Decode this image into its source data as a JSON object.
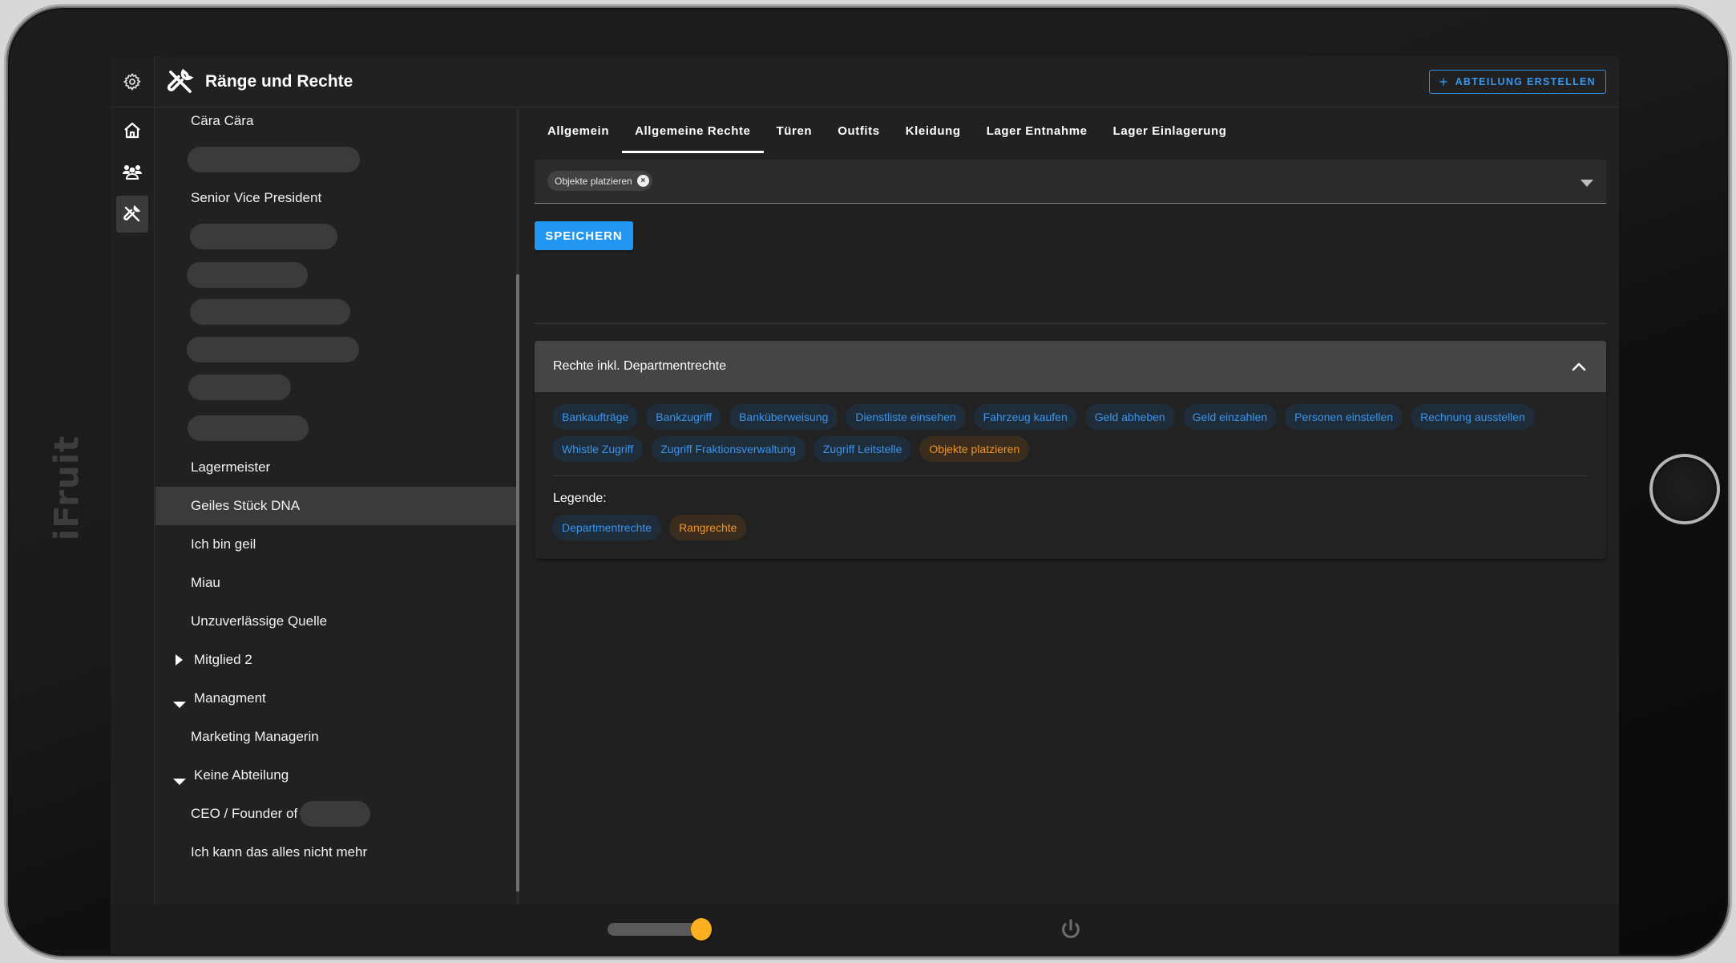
{
  "device": {
    "brand": "iFruit",
    "brand_logo_icon": "ifruit-logo-icon",
    "home_button_icon": "home-button-icon"
  },
  "rail": {
    "items": [
      {
        "name": "settings",
        "icon": "gear-icon",
        "active": false
      },
      {
        "name": "home",
        "icon": "home-icon",
        "active": false
      },
      {
        "name": "members",
        "icon": "users-icon",
        "active": false
      },
      {
        "name": "ranks",
        "icon": "tools-icon",
        "active": true
      }
    ]
  },
  "header": {
    "icon": "tools-icon",
    "title": "Ränge und Rechte",
    "create_button_label": "ABTEILUNG ERSTELLEN",
    "create_button_icon": "plus-icon"
  },
  "rank_list": {
    "items": [
      {
        "label": "Cära Cära",
        "type": "rank"
      },
      {
        "label": "",
        "type": "redacted"
      },
      {
        "label": "Senior Vice President",
        "type": "rank"
      },
      {
        "label": "",
        "type": "redacted"
      },
      {
        "label": "",
        "type": "redacted"
      },
      {
        "label": "",
        "type": "redacted"
      },
      {
        "label": "",
        "type": "redacted"
      },
      {
        "label": "",
        "type": "redacted"
      },
      {
        "label": "",
        "type": "redacted"
      },
      {
        "label": "Lagermeister",
        "type": "rank"
      },
      {
        "label": "Geiles Stück DNA",
        "type": "rank",
        "selected": true
      },
      {
        "label": "Ich bin geil",
        "type": "rank"
      },
      {
        "label": "Miau",
        "type": "rank"
      },
      {
        "label": "Unzuverlässige Quelle",
        "type": "rank"
      },
      {
        "label": "Mitglied 2",
        "type": "department",
        "expanded": false
      },
      {
        "label": "Managment",
        "type": "department",
        "expanded": true
      },
      {
        "label": "Marketing Managerin",
        "type": "rank"
      },
      {
        "label": "Keine Abteilung",
        "type": "department",
        "expanded": true
      },
      {
        "label": "CEO / Founder of",
        "type": "rank",
        "partially_redacted": true
      },
      {
        "label": "Ich kann das alles nicht mehr",
        "type": "rank"
      }
    ]
  },
  "tabs": [
    {
      "label": "Allgemein",
      "active": false
    },
    {
      "label": "Allgemeine Rechte",
      "active": true
    },
    {
      "label": "Türen",
      "active": false
    },
    {
      "label": "Outfits",
      "active": false
    },
    {
      "label": "Kleidung",
      "active": false
    },
    {
      "label": "Lager Entnahme",
      "active": false
    },
    {
      "label": "Lager Einlagerung",
      "active": false
    }
  ],
  "permission_select": {
    "selected": [
      "Objekte platzieren"
    ],
    "remove_icon": "close-icon",
    "dropdown_icon": "caret-down-icon"
  },
  "save_button_label": "SPEICHERN",
  "rights_panel": {
    "title": "Rechte inkl. Departmentrechte",
    "expanded": true,
    "toggle_icon": "chevron-up-icon",
    "rights": [
      {
        "label": "Bankaufträge",
        "kind": "department"
      },
      {
        "label": "Bankzugriff",
        "kind": "department"
      },
      {
        "label": "Banküberweisung",
        "kind": "department"
      },
      {
        "label": "Dienstliste einsehen",
        "kind": "department"
      },
      {
        "label": "Fahrzeug kaufen",
        "kind": "department"
      },
      {
        "label": "Geld abheben",
        "kind": "department"
      },
      {
        "label": "Geld einzahlen",
        "kind": "department"
      },
      {
        "label": "Personen einstellen",
        "kind": "department"
      },
      {
        "label": "Rechnung ausstellen",
        "kind": "department"
      },
      {
        "label": "Whistle Zugriff",
        "kind": "department"
      },
      {
        "label": "Zugriff Fraktionsverwaltung",
        "kind": "department"
      },
      {
        "label": "Zugriff Leitstelle",
        "kind": "department"
      },
      {
        "label": "Objekte platzieren",
        "kind": "rank"
      }
    ],
    "legend_label": "Legende:",
    "legend": [
      {
        "label": "Departmentrechte",
        "kind": "department"
      },
      {
        "label": "Rangrechte",
        "kind": "rank"
      }
    ]
  },
  "colors": {
    "accent_blue": "#2196f3",
    "department_tag_text": "#3a94ec",
    "rank_tag_text": "#f59324",
    "slider_thumb": "#fbb11f"
  },
  "bottom_bar": {
    "slider_value_percent": 100,
    "power_icon": "power-icon"
  }
}
